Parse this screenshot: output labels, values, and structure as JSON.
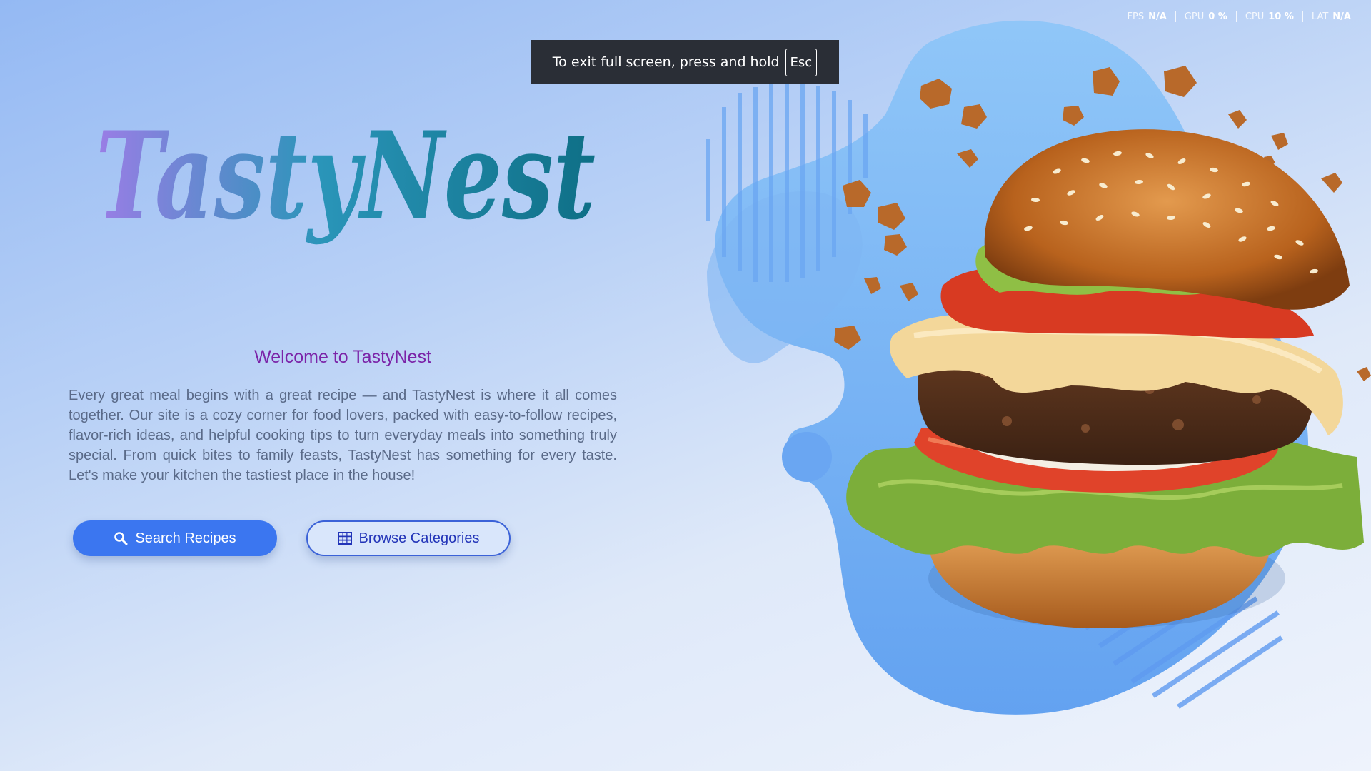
{
  "perf": {
    "items": [
      {
        "label": "FPS",
        "value": "N/A"
      },
      {
        "label": "GPU",
        "value": "0 %"
      },
      {
        "label": "CPU",
        "value": "10 %"
      },
      {
        "label": "LAT",
        "value": "N/A"
      }
    ]
  },
  "fullscreen_toast": {
    "message": "To exit full screen, press and hold",
    "key": "Esc"
  },
  "hero": {
    "logo_text": "TastyNest",
    "welcome": "Welcome to TastyNest",
    "intro": "Every great meal begins with a great recipe — and TastyNest is where it all comes together. Our site is a cozy corner for food lovers, packed with easy-to-follow recipes, flavor-rich ideas, and helpful cooking tips to turn everyday meals into something truly special. From quick bites to family feasts, TastyNest has something for every taste. Let's make your kitchen the tastiest place in the house!"
  },
  "actions": {
    "search_label": "Search Recipes",
    "browse_label": "Browse Categories"
  },
  "icons": {
    "search": "search-icon",
    "grid": "grid-icon",
    "hero_image": "burger-illustration"
  },
  "colors": {
    "logo_gradient_start": "#9b7de6",
    "logo_gradient_mid": "#2a95b9",
    "logo_gradient_end": "#0e6f86",
    "welcome": "#7b24a8",
    "primary_button": "#3b76f0",
    "blob": "#6fa9f3",
    "toast_bg": "#2a2e36"
  }
}
